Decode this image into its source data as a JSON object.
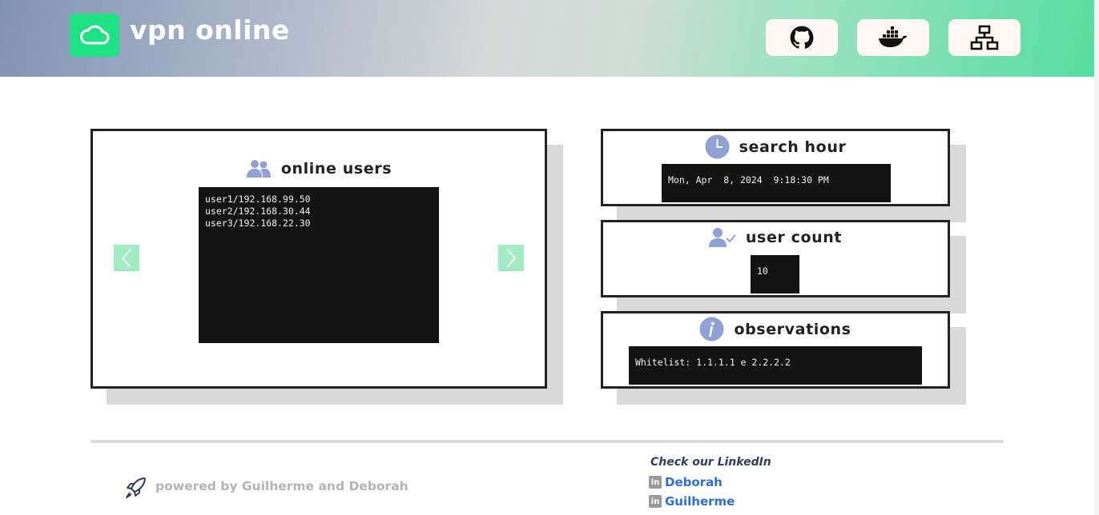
{
  "header": {
    "title": "vpn online",
    "buttons": [
      {
        "name": "github-icon"
      },
      {
        "name": "docker-icon"
      },
      {
        "name": "network-icon"
      }
    ]
  },
  "online_users": {
    "title": "online users",
    "lines": "user1/192.168.99.50\nuser2/192.168.30.44\nuser3/192.168.22.30"
  },
  "search_hour": {
    "title": "search hour",
    "value": "Mon, Apr  8, 2024  9:18:30 PM"
  },
  "user_count": {
    "title": "user count",
    "value": "10"
  },
  "observations": {
    "title": "observations",
    "value": "Whitelist: 1.1.1.1 e 2.2.2.2"
  },
  "footer": {
    "powered": "powered by Guilherme and Deborah",
    "check_linkedin": "Check our LinkedIn",
    "links": [
      {
        "badge": "in",
        "label": "Deborah"
      },
      {
        "badge": "in",
        "label": "Guilherme"
      }
    ]
  },
  "colors": {
    "accent_green": "#1ee184",
    "arrow_green": "#a2ecc4",
    "icon_blue": "#8ea2d3",
    "link_blue": "#2b6fd8",
    "terminal_bg": "#131313"
  }
}
